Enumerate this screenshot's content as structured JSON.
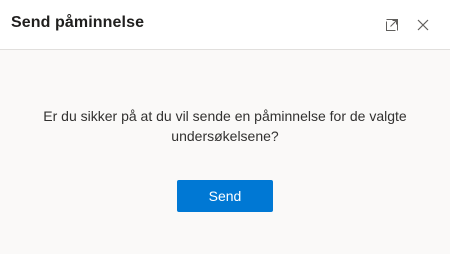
{
  "dialog": {
    "title": "Send påminnelse",
    "expand_icon": "expand-icon",
    "close_icon": "close-icon",
    "message_line1": "Er du sikker på at du vil sende en påminnelse for de valgte",
    "message_line2": "undersøkelsene?",
    "send_label": "Send"
  },
  "colors": {
    "accent": "#0078d4",
    "body_background": "#faf9f8",
    "header_background": "#ffffff",
    "text": "#323130"
  }
}
